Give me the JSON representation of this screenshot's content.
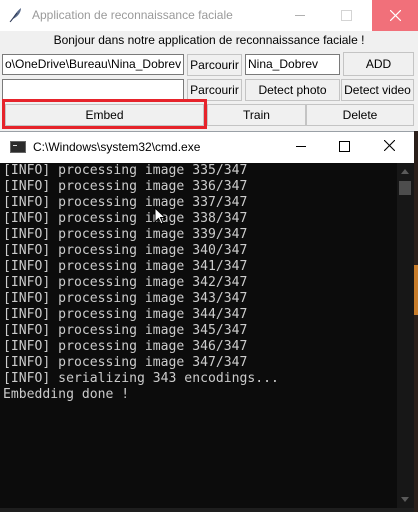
{
  "app": {
    "title": "Application de reconnaissance faciale",
    "greeting": "Bonjour dans notre application de reconnaissance faciale !",
    "path_value": "o\\OneDrive\\Bureau\\Nina_Dobrev",
    "browse_label_1": "Parcourir",
    "name_value": "Nina_Dobrev",
    "add_label": "ADD",
    "second_path_value": "",
    "browse_label_2": "Parcourir",
    "detect_photo_label": "Detect photo",
    "detect_video_label": "Detect video",
    "embed_label": "Embed",
    "train_label": "Train",
    "delete_label": "Delete",
    "close_button_color": "#f1707a",
    "highlight_color": "#e6232b"
  },
  "cmd": {
    "title": "C:\\Windows\\system32\\cmd.exe",
    "lines": [
      "[INFO] processing image 335/347",
      "[INFO] processing image 336/347",
      "[INFO] processing image 337/347",
      "[INFO] processing image 338/347",
      "[INFO] processing image 339/347",
      "[INFO] processing image 340/347",
      "[INFO] processing image 341/347",
      "[INFO] processing image 342/347",
      "[INFO] processing image 343/347",
      "[INFO] processing image 344/347",
      "[INFO] processing image 345/347",
      "[INFO] processing image 346/347",
      "[INFO] processing image 347/347",
      "[INFO] serializing 343 encodings...",
      "Embedding done !"
    ]
  }
}
